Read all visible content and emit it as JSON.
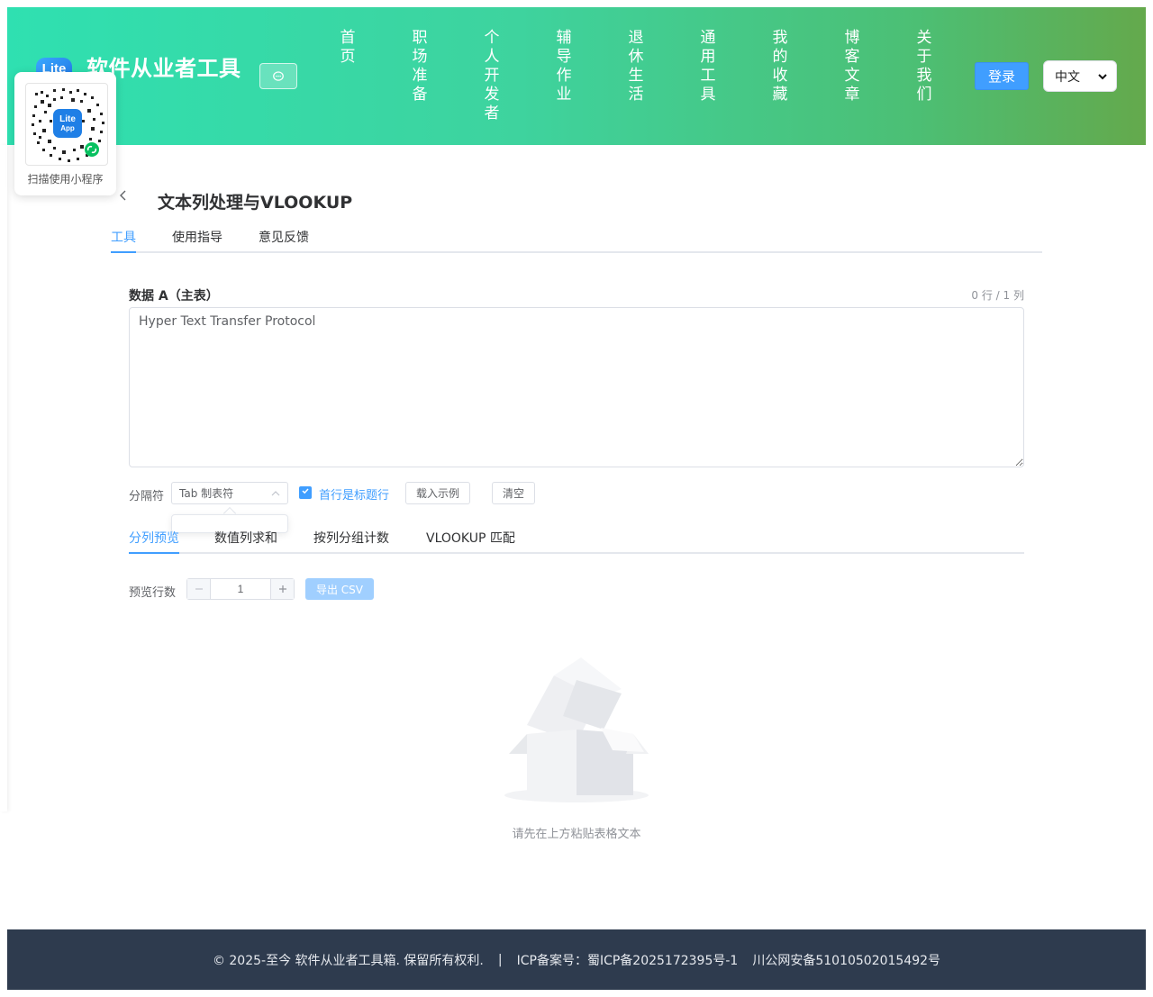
{
  "header": {
    "logo_text": "Lite",
    "site_title": "软件从业者工具",
    "nav": [
      "首页",
      "职场准备",
      "个人开发者",
      "辅导作业",
      "退休生活",
      "通用工具",
      "我的收藏",
      "博客文章",
      "关于我们"
    ],
    "login_label": "登录",
    "language": "中文"
  },
  "qr": {
    "caption": "扫描使用小程序",
    "badge_text": "Lite App"
  },
  "page": {
    "title": "文本列处理与VLOOKUP",
    "tabs": [
      "工具",
      "使用指导",
      "意见反馈"
    ]
  },
  "tool": {
    "data_a_label": "数据 A（主表）",
    "row_col_count": "0 行 / 1 列",
    "data_a_value": "Hyper Text Transfer Protocol",
    "separator_label": "分隔符",
    "separator_value": "Tab 制表符",
    "header_row_label": "首行是标题行",
    "header_row_checked": true,
    "load_example_label": "载入示例",
    "clear_label": "清空",
    "sub_tabs": [
      "分列预览",
      "数值列求和",
      "按列分组计数",
      "VLOOKUP 匹配"
    ],
    "preview_rows_label": "预览行数",
    "preview_rows_value": "1",
    "export_label": "导出 CSV",
    "empty_text": "请先在上方粘贴表格文本"
  },
  "footer": {
    "copyright": "© 2025-至今 软件从业者工具箱. 保留所有权利.",
    "divider": "|",
    "icp": "ICP备案号：蜀ICP备2025172395号-1",
    "police": "川公网安备51010502015492号"
  },
  "colors": {
    "accent": "#409eff",
    "header_start": "#2fe0b1",
    "header_end": "#64a94c",
    "footer_bg": "#2e3b4e"
  }
}
